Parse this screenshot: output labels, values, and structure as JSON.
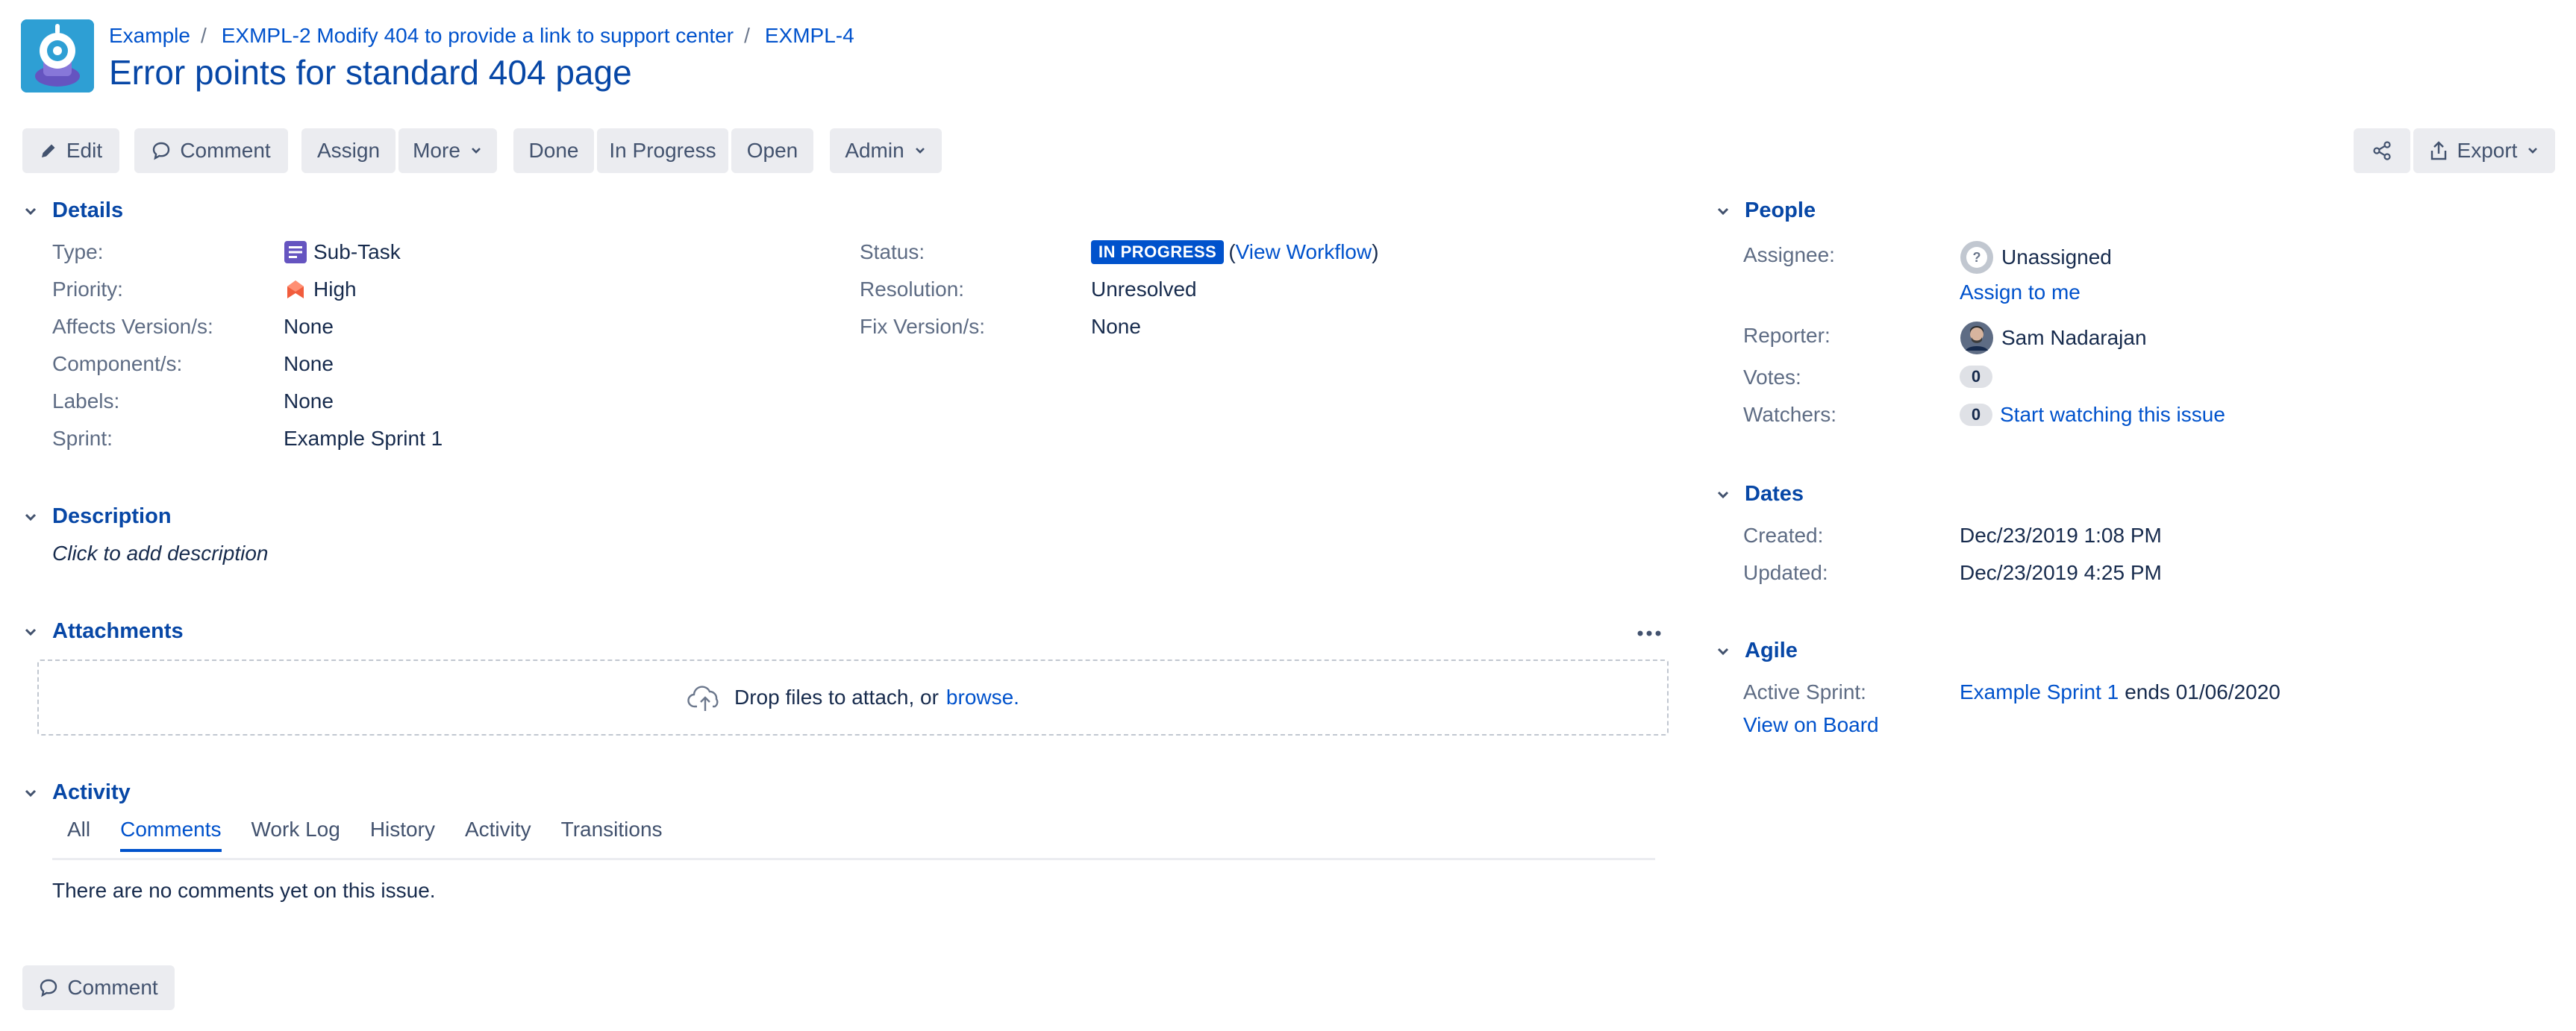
{
  "breadcrumbs": {
    "project": "Example",
    "sep": "/",
    "parent": "EXMPL-2 Modify 404 to provide a link to support center",
    "issue_key": "EXMPL-4"
  },
  "summary": "Error points for standard 404 page",
  "toolbar": {
    "edit": "Edit",
    "comment": "Comment",
    "assign": "Assign",
    "more": "More",
    "done": "Done",
    "in_progress": "In Progress",
    "open": "Open",
    "admin": "Admin",
    "export": "Export"
  },
  "details": {
    "heading": "Details",
    "type_label": "Type:",
    "type_value": "Sub-Task",
    "priority_label": "Priority:",
    "priority_value": "High",
    "affects_label": "Affects Version/s:",
    "affects_value": "None",
    "component_label": "Component/s:",
    "component_value": "None",
    "labels_label": "Labels:",
    "labels_value": "None",
    "sprint_label": "Sprint:",
    "sprint_value": "Example Sprint 1",
    "status_label": "Status:",
    "status_value": "IN PROGRESS",
    "paren_open": "(",
    "view_workflow": "View Workflow",
    "paren_close": ")",
    "resolution_label": "Resolution:",
    "resolution_value": "Unresolved",
    "fix_label": "Fix Version/s:",
    "fix_value": "None"
  },
  "description": {
    "heading": "Description",
    "placeholder": "Click to add description"
  },
  "attachments": {
    "heading": "Attachments",
    "drop_text": "Drop files to attach, or",
    "browse": "browse."
  },
  "activity": {
    "heading": "Activity",
    "tabs": [
      "All",
      "Comments",
      "Work Log",
      "History",
      "Activity",
      "Transitions"
    ],
    "active_tab": "Comments",
    "empty": "There are no comments yet on this issue.",
    "comment_button": "Comment"
  },
  "people": {
    "heading": "People",
    "assignee_label": "Assignee:",
    "assignee_value": "Unassigned",
    "assign_to_me": "Assign to me",
    "reporter_label": "Reporter:",
    "reporter_value": "Sam Nadarajan",
    "votes_label": "Votes:",
    "votes_count": "0",
    "watchers_label": "Watchers:",
    "watchers_count": "0",
    "start_watching": "Start watching this issue"
  },
  "dates": {
    "heading": "Dates",
    "created_label": "Created:",
    "created_value": "Dec/23/2019 1:08 PM",
    "updated_label": "Updated:",
    "updated_value": "Dec/23/2019 4:25 PM"
  },
  "agile": {
    "heading": "Agile",
    "active_sprint_label": "Active Sprint:",
    "sprint_link": "Example Sprint 1",
    "sprint_ends": "ends 01/06/2020",
    "view_on_board": "View on Board"
  },
  "colors": {
    "link": "#0052cc",
    "heading": "#0747a6",
    "button_bg": "#ebecf0",
    "lozenge_in_progress": "#0052cc",
    "priority_high": "#f15c3c",
    "subtask": "#6554c0"
  },
  "icons": [
    "project-avatar-icon",
    "pencil-icon",
    "comment-bubble-icon",
    "chevron-down-icon",
    "share-icon",
    "export-icon",
    "subtask-icon",
    "priority-high-icon",
    "unknown-user-icon",
    "user-avatar-icon",
    "cloud-upload-icon",
    "more-dots-icon"
  ]
}
